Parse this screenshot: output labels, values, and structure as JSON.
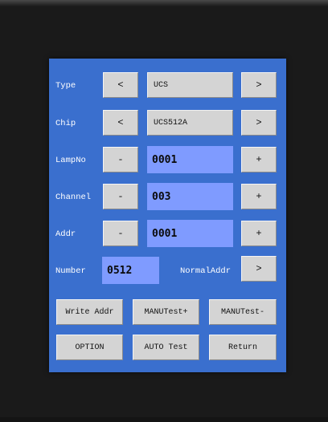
{
  "labels": {
    "type": "Type",
    "chip": "Chip",
    "lampno": "LampNo",
    "channel": "Channel",
    "addr": "Addr",
    "number": "Number",
    "normal_addr": "NormalAddr"
  },
  "fields": {
    "type_value": "UCS",
    "chip_value": "UCS512A",
    "lampno_value": "0001",
    "channel_value": "003",
    "addr_value": "0001",
    "number_value": "0512"
  },
  "controls": {
    "prev": "<",
    "next": ">",
    "minus": "-",
    "plus": "+"
  },
  "buttons": {
    "write_addr": "Write Addr",
    "manu_test_plus": "MANUTest+",
    "manu_test_minus": "MANUTest-",
    "option": "OPTION",
    "auto_test": "AUTO Test",
    "return": "Return"
  },
  "colors": {
    "panel": "#3a6fce",
    "value_field": "#7f9bff",
    "button": "#d4d4d4",
    "background": "#1a1a1a"
  }
}
